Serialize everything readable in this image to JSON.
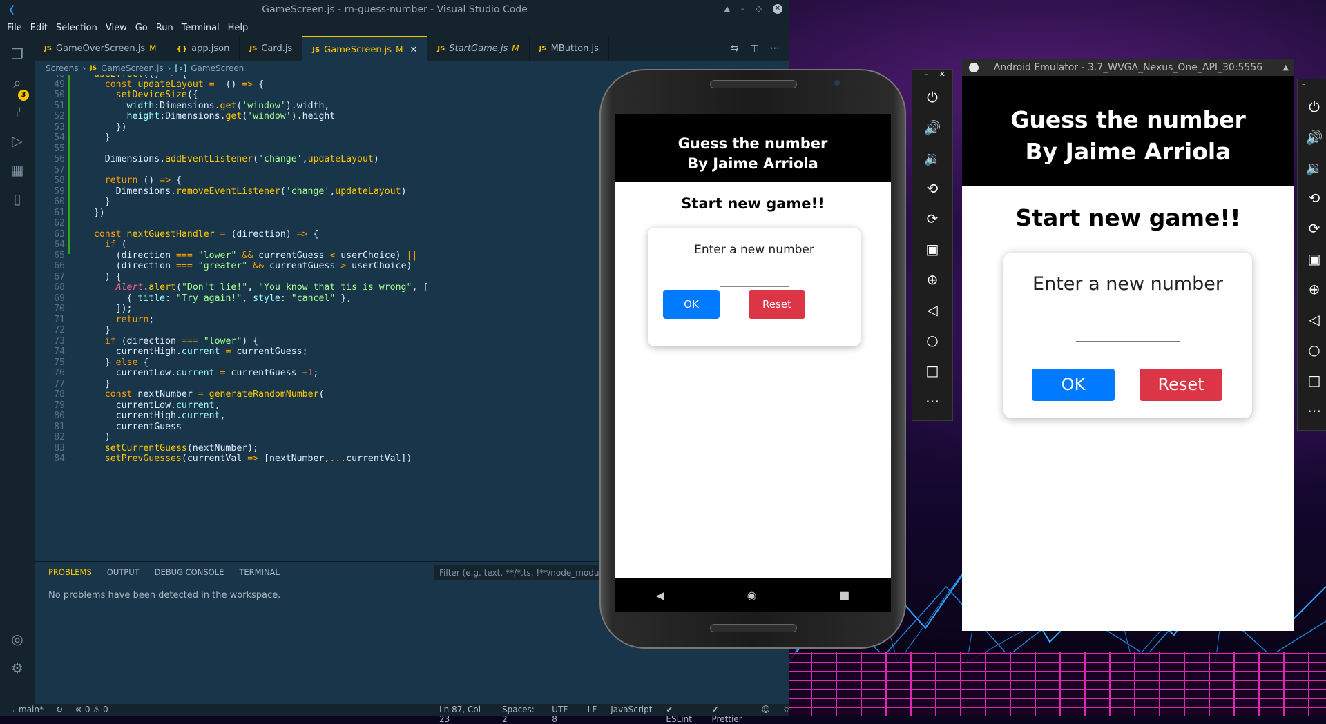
{
  "vscode": {
    "title": "GameScreen.js - rn-guess-number - Visual Studio Code",
    "menu": [
      "File",
      "Edit",
      "Selection",
      "View",
      "Go",
      "Run",
      "Terminal",
      "Help"
    ],
    "scm_badge": "3",
    "tabs": [
      {
        "label": "GameOverScreen.js",
        "kind": "JS",
        "mod": "M"
      },
      {
        "label": "app.json",
        "kind": "{}",
        "mod": ""
      },
      {
        "label": "Card.js",
        "kind": "JS",
        "mod": ""
      },
      {
        "label": "GameScreen.js",
        "kind": "JS",
        "mod": "M"
      },
      {
        "label": "StartGame.js",
        "kind": "JS",
        "mod": "M"
      },
      {
        "label": "MButton.js",
        "kind": "JS",
        "mod": ""
      }
    ],
    "breadcrumb": {
      "folder": "Screens",
      "file": "GameScreen.js",
      "symbol": "GameScreen"
    },
    "panel": {
      "tabs": [
        "PROBLEMS",
        "OUTPUT",
        "DEBUG CONSOLE",
        "TERMINAL"
      ],
      "filter_placeholder": "Filter (e.g. text, **/*.ts, !**/node_modules/**)",
      "message": "No problems have been detected in the workspace."
    },
    "status": {
      "branch": "main*",
      "problems": "⊗ 0 ⚠ 0",
      "position": "Ln 87, Col 23",
      "spaces": "Spaces: 2",
      "encoding": "UTF-8",
      "eol": "LF",
      "language": "JavaScript",
      "eslint": "✔ ESLint",
      "prettier": "✔ Prettier"
    }
  },
  "phone": {
    "header_line1": "Guess the number",
    "header_line2": "By Jaime Arriola",
    "screen_title": "Start new game!!",
    "card_label": "Enter a new number",
    "ok_label": "OK",
    "reset_label": "Reset"
  },
  "emulator2": {
    "window_title": "Android Emulator - 3.7_WVGA_Nexus_One_API_30:5556",
    "header_line1": "Guess the number",
    "header_line2": "By Jaime Arriola",
    "screen_title": "Start new game!!",
    "card_label": "Enter a new number",
    "ok_label": "OK",
    "reset_label": "Reset"
  },
  "colors": {
    "accent": "#ffc600",
    "ok": "#007bff",
    "reset": "#dc3545",
    "editor_bg": "#193549"
  }
}
